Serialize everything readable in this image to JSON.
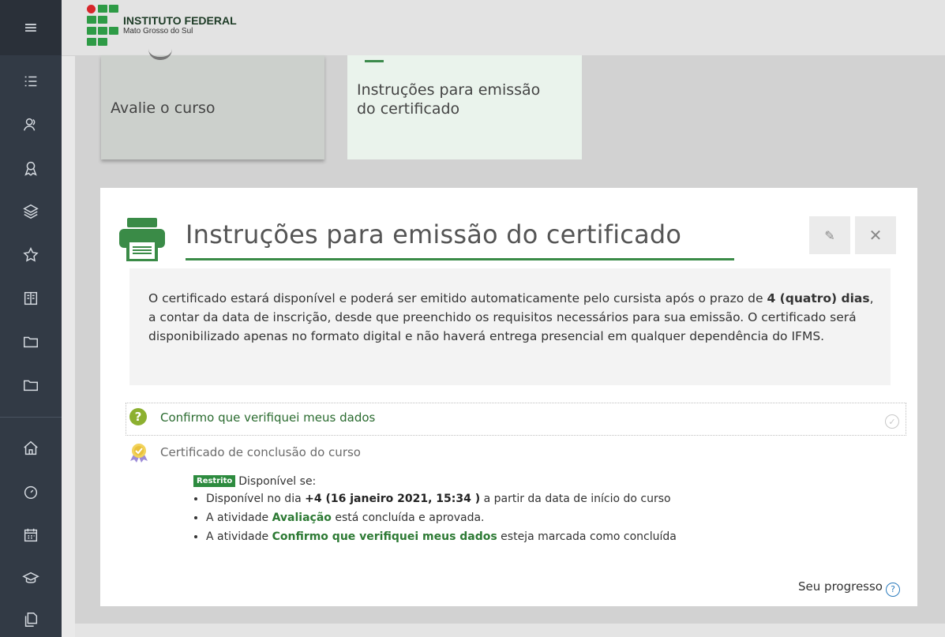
{
  "header": {
    "logo_title": "INSTITUTO FEDERAL",
    "logo_subtitle": "Mato Grosso do Sul"
  },
  "sidebar": {
    "icons": [
      "menu-icon",
      "list-icon",
      "users-icon",
      "badge-icon",
      "layers-icon",
      "star-icon",
      "book-icon",
      "folder-icon",
      "folder-icon",
      "home-icon",
      "dashboard-icon",
      "calendar-icon",
      "graduation-cap-icon",
      "copy-icon"
    ]
  },
  "tiles": [
    {
      "label": "Avalie o curso"
    },
    {
      "label": "Instruções para emissão do certificado"
    }
  ],
  "card": {
    "title": "Instruções para emissão do certificado",
    "info_part1": "O certificado estará disponível e poderá ser emitido automaticamente pelo cursista após o prazo de ",
    "info_bold": "4 (quatro) dias",
    "info_part2": ", a contar da data de inscrição, desde que preenchido os requisitos necessários para sua emissão. O certificado será disponibilizado apenas no formato digital e não haverá entrega presencial em qualquer dependência do IFMS.",
    "activity_label": "Confirmo que verifiquei meus dados",
    "certificate_label": "Certificado de conclusão do curso",
    "restrict_badge": "Restrito",
    "restrict_intro": "Disponível se:",
    "cond1_prefix": "Disponível no dia ",
    "cond1_bold": "+4 (16 janeiro 2021, 15:34 )",
    "cond1_suffix": " a partir da data de início do curso",
    "cond2_prefix": "A atividade ",
    "cond2_link": "Avaliação",
    "cond2_suffix": " está concluída e aprovada.",
    "cond3_prefix": "A atividade ",
    "cond3_link": "Confirmo que verifiquei meus dados",
    "cond3_suffix": " esteja marcada como concluída",
    "progress_label": "Seu progresso"
  },
  "colors": {
    "sidebar": "#323a45",
    "accent_green": "#2d8b3f",
    "logo_red": "#d7262b"
  }
}
